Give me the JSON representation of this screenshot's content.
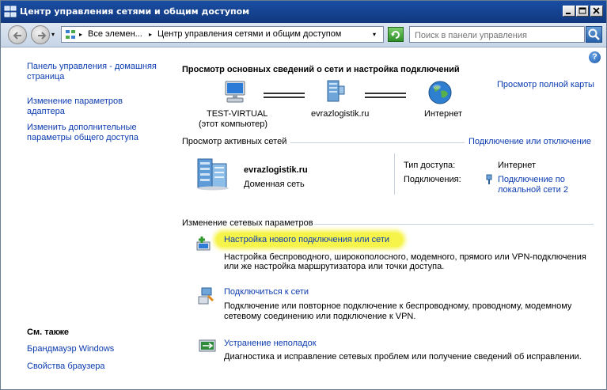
{
  "window": {
    "title": "Центр управления сетями и общим доступом"
  },
  "address_bar": {
    "crumb_1": "Все элемен...",
    "crumb_2": "Центр управления сетями и общим доступом",
    "separator": "▸"
  },
  "search": {
    "placeholder": "Поиск в панели управления"
  },
  "sidebar": {
    "home_line1": "Панель управления - домашняя",
    "home_line2": "страница",
    "adapter_line1": "Изменение параметров",
    "adapter_line2": "адаптера",
    "sharing_line1": "Изменить дополнительные",
    "sharing_line2": "параметры общего доступа",
    "see_also": "См. также",
    "firewall": "Брандмауэр Windows",
    "browser": "Свойства браузера"
  },
  "main": {
    "heading": "Просмотр основных сведений о сети и настройка подключений",
    "full_map": "Просмотр полной карты",
    "map": {
      "computer_name": "TEST-VIRTUAL",
      "computer_sub": "(этот компьютер)",
      "domain": "evrazlogistik.ru",
      "internet": "Интернет"
    },
    "active_networks_title": "Просмотр активных сетей",
    "connect_disconnect": "Подключение или отключение",
    "network": {
      "name": "evrazlogistik.ru",
      "type": "Доменная сеть",
      "access_label": "Тип доступа:",
      "access_value": "Интернет",
      "connections_label": "Подключения:",
      "connection_line1": "Подключение по",
      "connection_line2": "локальной сети 2"
    },
    "change_settings_title": "Изменение сетевых параметров",
    "tasks": [
      {
        "title": "Настройка нового подключения или сети",
        "desc_line1": "Настройка беспроводного, широкополосного, модемного, прямого или VPN-подключения",
        "desc_line2": "или же настройка маршрутизатора или точки доступа."
      },
      {
        "title": "Подключиться к сети",
        "desc_line1": "Подключение или повторное подключение к беспроводному, проводному, модемному",
        "desc_line2": "сетевому соединению или подключение к VPN."
      },
      {
        "title": "Устранение неполадок",
        "desc_line1": "Диагностика и исправление сетевых проблем или получение сведений об исправлении.",
        "desc_line2": ""
      }
    ]
  },
  "colors": {
    "link": "#0b3bb0",
    "titlebar": "#1a4ea3",
    "highlight": "#f6f44a"
  }
}
